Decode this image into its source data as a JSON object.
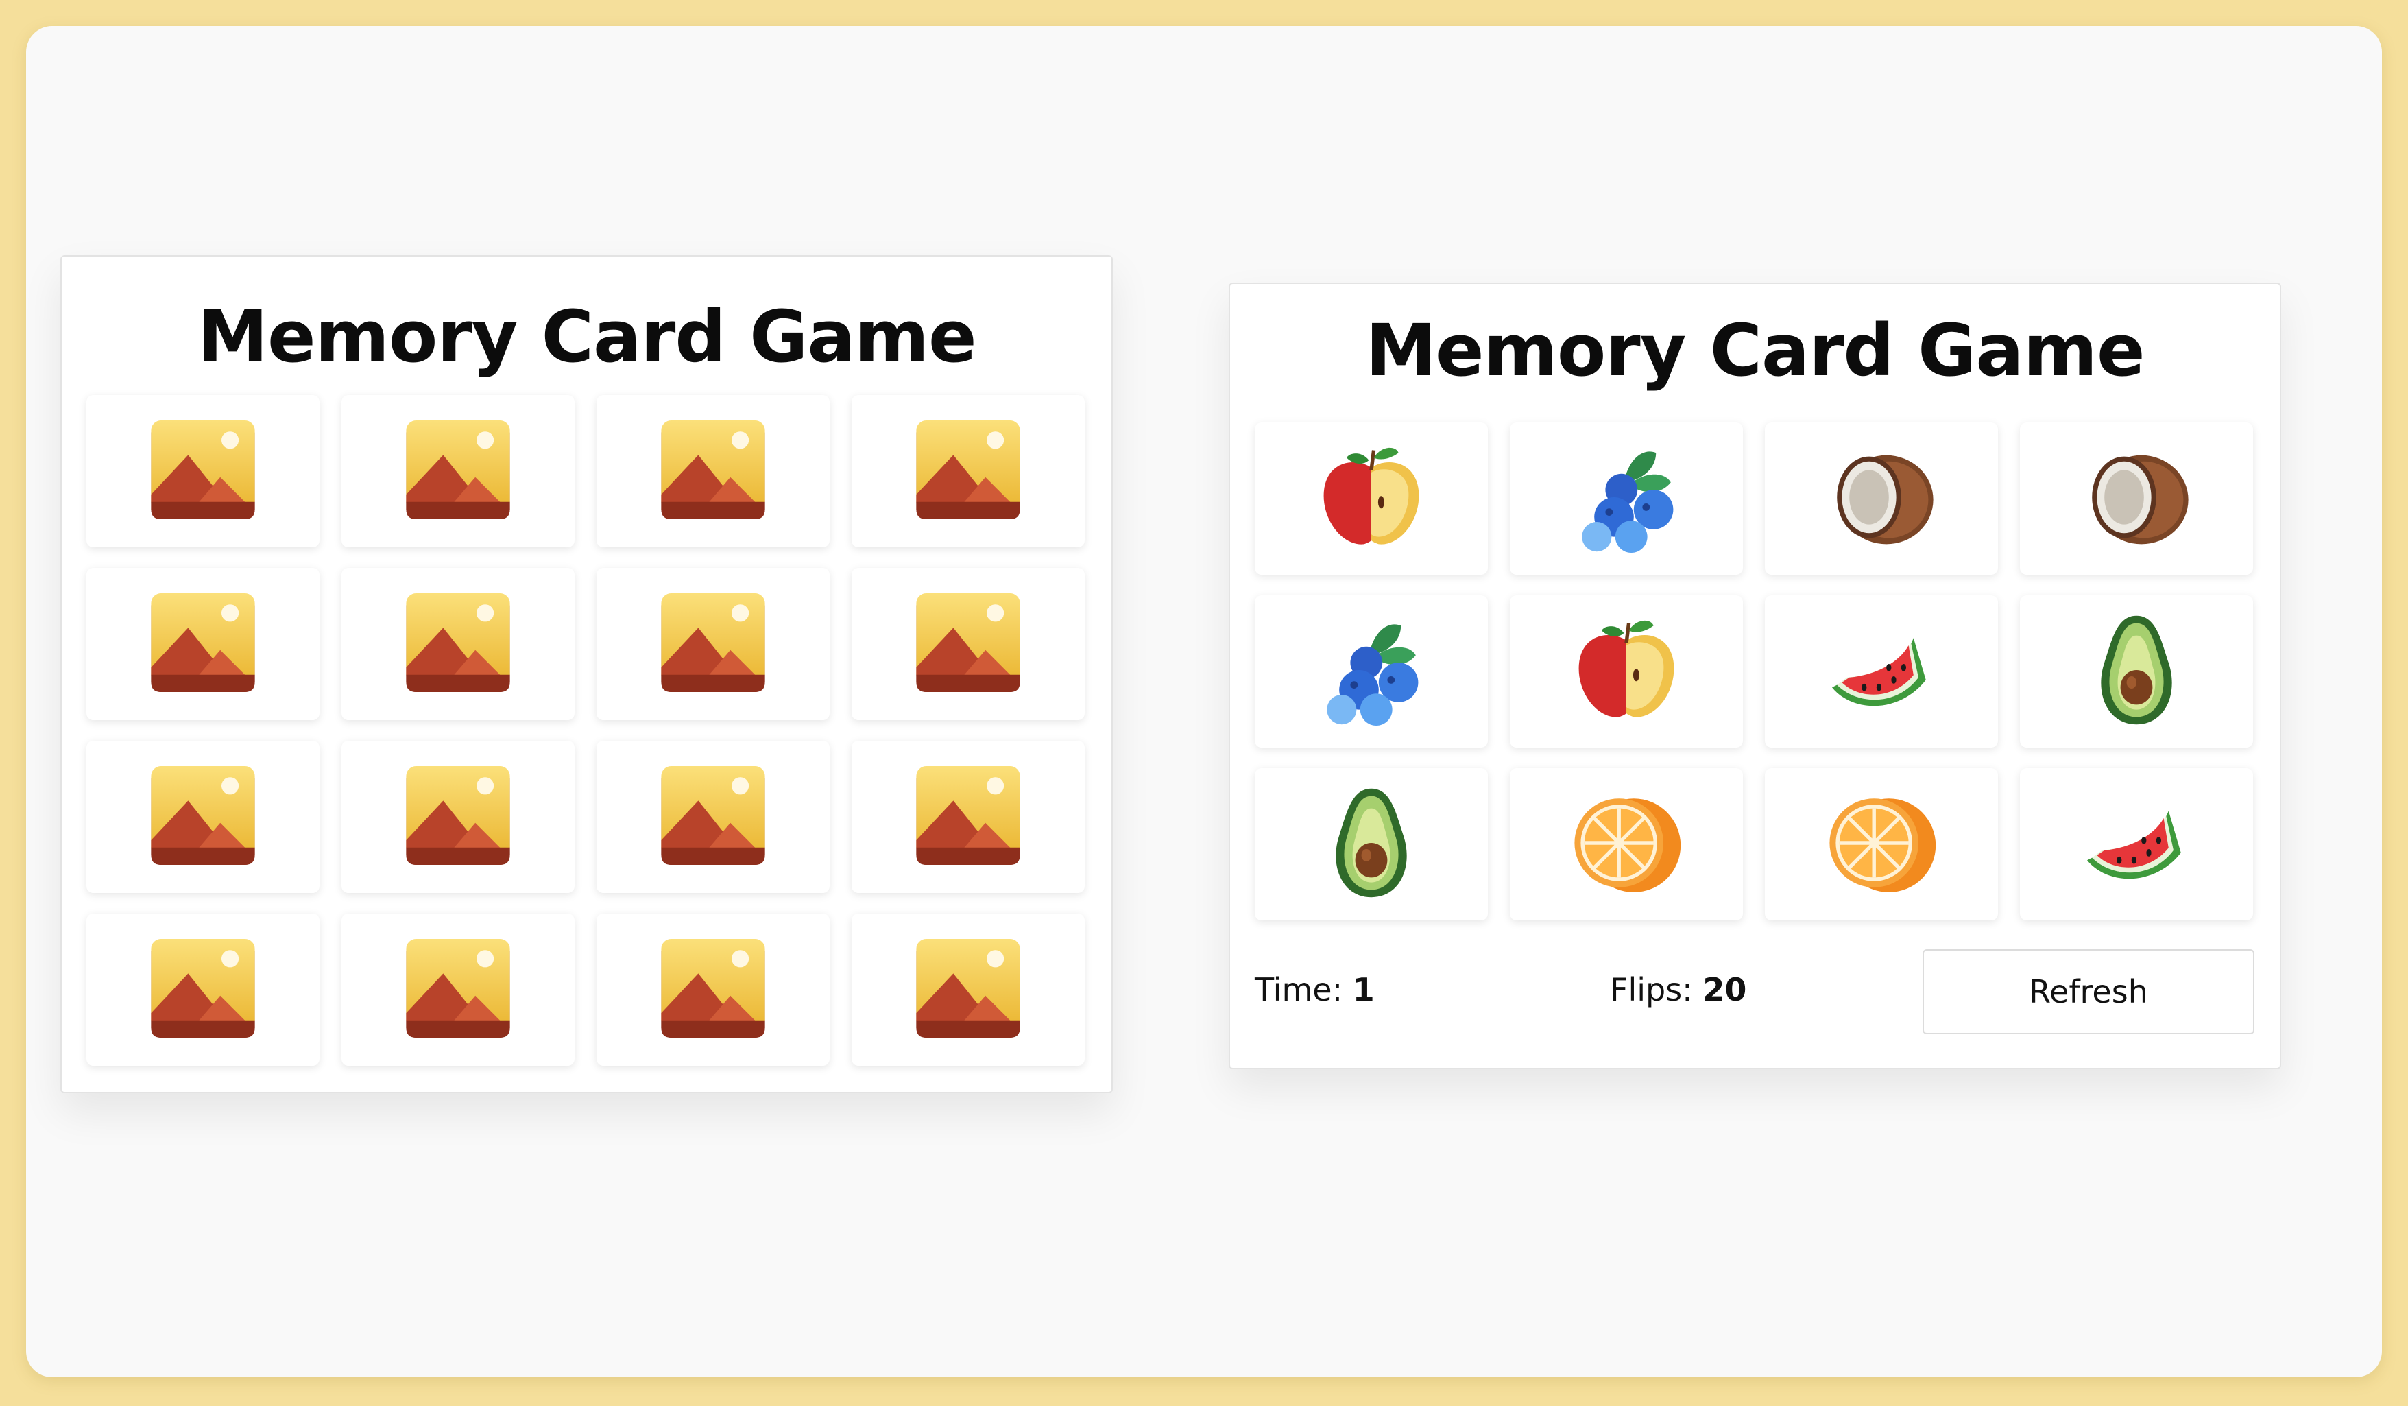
{
  "left_board": {
    "title": "Memory Card Game",
    "cards": [
      "image-icon",
      "image-icon",
      "image-icon",
      "image-icon",
      "image-icon",
      "image-icon",
      "image-icon",
      "image-icon",
      "image-icon",
      "image-icon",
      "image-icon",
      "image-icon",
      "image-icon",
      "image-icon",
      "image-icon",
      "image-icon"
    ]
  },
  "right_board": {
    "title": "Memory Card Game",
    "cards": [
      "apple-icon",
      "blueberry-icon",
      "coconut-icon",
      "coconut-icon",
      "blueberry-icon",
      "apple-icon",
      "watermelon-icon",
      "avocado-icon",
      "avocado-icon",
      "orange-icon",
      "orange-icon",
      "watermelon-icon"
    ],
    "time_label": "Time:",
    "time_value": "1",
    "flips_label": "Flips:",
    "flips_value": "20",
    "refresh_label": "Refresh"
  },
  "colors": {
    "page_background": "#f5df9b",
    "frame_background": "#f9f9f9",
    "card_background": "#ffffff"
  }
}
